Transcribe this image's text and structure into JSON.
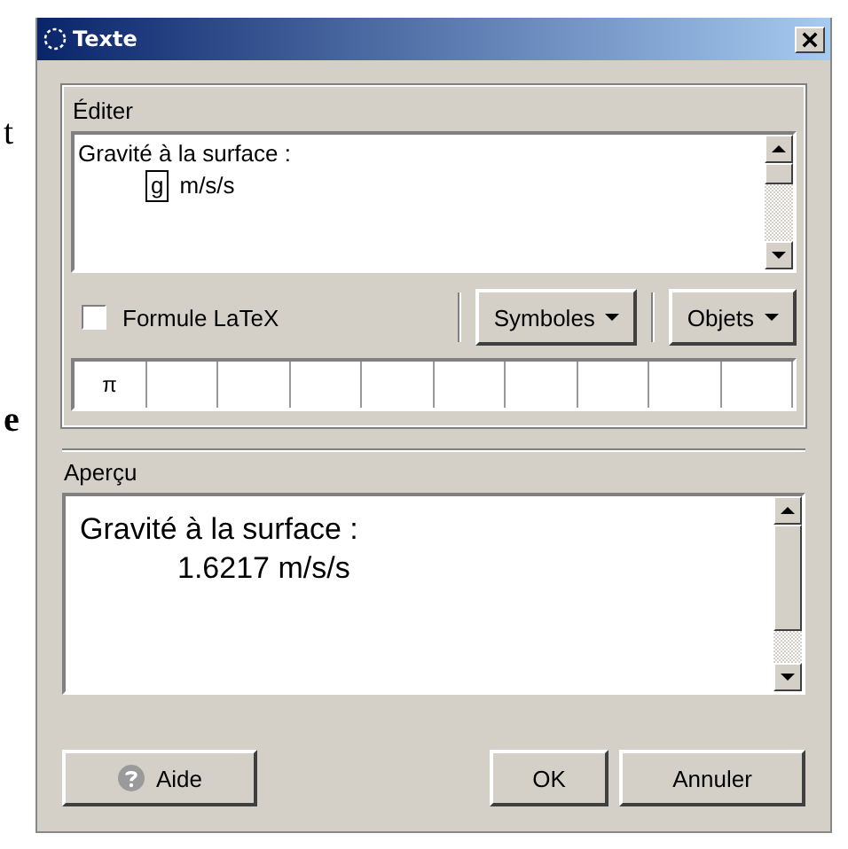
{
  "background_text": [
    "t",
    "e"
  ],
  "window": {
    "title": "Texte"
  },
  "editor": {
    "label": "Éditer",
    "lines": [
      {
        "kind": "text",
        "text": "Gravité à la surface :"
      },
      {
        "kind": "object",
        "object": "g",
        "text": "m/s/s"
      }
    ]
  },
  "latex": {
    "label": "Formule LaTeX",
    "checked": false
  },
  "menus": [
    "Symboles",
    "Objets"
  ],
  "symbols": [
    "π"
  ],
  "preview": {
    "label": "Aperçu",
    "lines": [
      "Gravité à la surface :",
      "1.6217 m/s/s"
    ]
  },
  "buttons": {
    "help": "Aide",
    "ok": "OK",
    "cancel": "Annuler"
  }
}
